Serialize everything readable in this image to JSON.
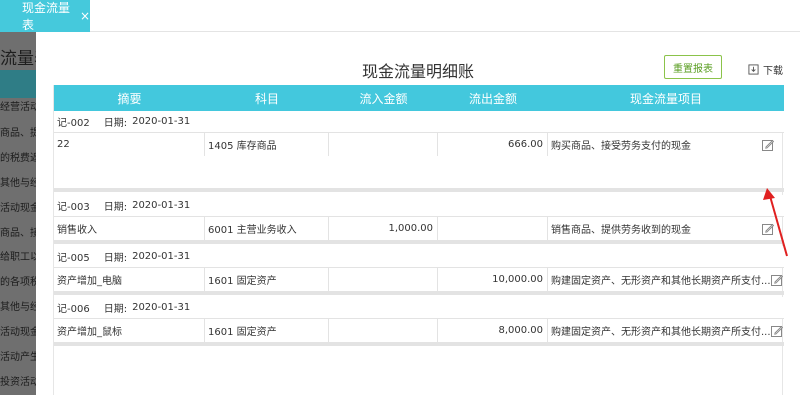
{
  "tab": {
    "label": "现金流量表",
    "close": "×"
  },
  "background": {
    "title": "流量表",
    "items": [
      "经营活动",
      "商品、提",
      "的税费返",
      "其他与经",
      "活动现金",
      "商品、接",
      "给职工以",
      "的各项税",
      "其他与经",
      "活动现金",
      "活动产生",
      "投资活动"
    ]
  },
  "modal": {
    "title": "现金流量明细账",
    "reset_label": "重置报表",
    "download_label": "下载",
    "columns": [
      "摘要",
      "科目",
      "流入金额",
      "流出金额",
      "现金流量项目"
    ],
    "date_prefix": "日期:",
    "groups": [
      {
        "voucher": "记-002",
        "date": "2020-01-31",
        "summary": "22",
        "subject": "1405 库存商品",
        "inflow": "",
        "outflow": "666.00",
        "item": "购买商品、接受劳务支付的现金"
      },
      {
        "voucher": "记-003",
        "date": "2020-01-31",
        "summary": "销售收入",
        "subject": "6001 主营业务收入",
        "inflow": "1,000.00",
        "outflow": "",
        "item": "销售商品、提供劳务收到的现金"
      },
      {
        "voucher": "记-005",
        "date": "2020-01-31",
        "summary": "资产增加_电脑",
        "subject": "1601 固定资产",
        "inflow": "",
        "outflow": "10,000.00",
        "item": "购建固定资产、无形资产和其他长期资产所支付..."
      },
      {
        "voucher": "记-006",
        "date": "2020-01-31",
        "summary": "资产增加_鼠标",
        "subject": "1601 固定资产",
        "inflow": "",
        "outflow": "8,000.00",
        "item": "购建固定资产、无形资产和其他长期资产所支付..."
      }
    ]
  },
  "colors": {
    "header": "#43c8dd",
    "tab": "#45c9dc",
    "reset_border": "#8bc34a",
    "arrow": "#e02020"
  }
}
